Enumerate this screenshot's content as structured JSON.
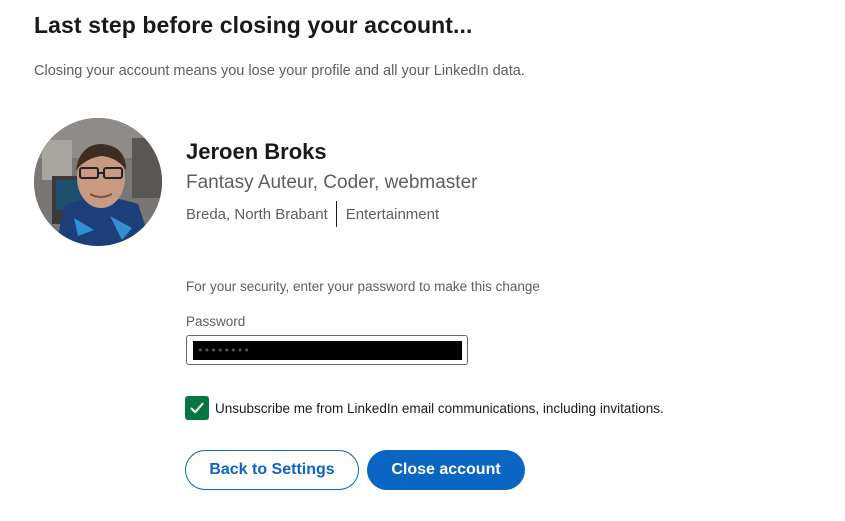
{
  "page": {
    "title": "Last step before closing your account...",
    "subtitle": "Closing your account means you lose your profile and all your LinkedIn data."
  },
  "profile": {
    "name": "Jeroen Broks",
    "headline": "Fantasy Auteur, Coder, webmaster",
    "location": "Breda, North Brabant",
    "industry": "Entertainment",
    "avatar_icon": "profile-photo"
  },
  "form": {
    "security_note": "For your security, enter your password to make this change",
    "password_label": "Password",
    "password_value": "••••••••"
  },
  "unsubscribe": {
    "checked": true,
    "label": "Unsubscribe me from LinkedIn email communications, including invitations."
  },
  "actions": {
    "back_label": "Back to Settings",
    "close_label": "Close account"
  },
  "colors": {
    "accent": "#0a66c2",
    "checkbox": "#057642",
    "text": "#191919",
    "muted": "#5e5e5e"
  }
}
